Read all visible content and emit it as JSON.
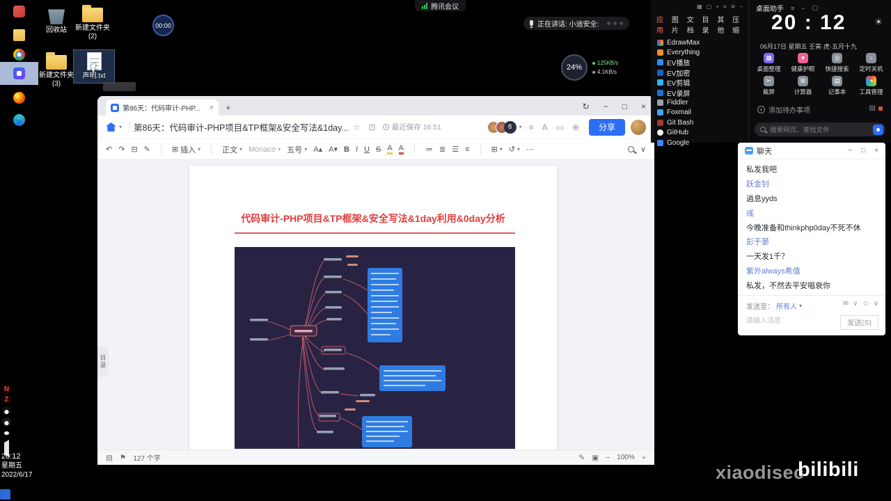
{
  "system": {
    "top_bar": {
      "app": "腾讯会议"
    },
    "speaking_pill": {
      "label": "正在讲话: 小迪安全:"
    },
    "timer": "00:00",
    "net_widget": {
      "percent": "24%",
      "up": "125KB/s",
      "down": "4.1KB/s"
    },
    "clock_small": {
      "time": "20:12",
      "weekday": "星期五",
      "date": "2022/6/17"
    },
    "watermark": {
      "author": "xiaodisec",
      "site": "bilibili"
    }
  },
  "desktop_icons": [
    {
      "label": "回收站"
    },
    {
      "label": "新建文件夹(2)"
    },
    {
      "label": "新建文件夹(3)"
    },
    {
      "label": "声明.txt"
    }
  ],
  "editor": {
    "tab_title": "第86天：代码审计-PHP...",
    "title": "第86天：代码审计-PHP项目&TP框架&安全写法&1day...",
    "saved_status": "最近保存 16:51",
    "collab_count": "8",
    "share_button": "分享",
    "toolbar": {
      "insert": "插入",
      "paragraph_style": "正文",
      "font_name": "Monaco",
      "font_size": "五号"
    },
    "document": {
      "heading": "代码审计-PHP项目&TP框架&安全写法&1day利用&0day分析"
    },
    "sidebar_tab": "目录",
    "status_bar": {
      "word_count": "127 个字",
      "zoom": "100%"
    }
  },
  "assistant": {
    "window_title": "桌面助手",
    "header_tabs": [
      "应用",
      "图片",
      "文档",
      "目录",
      "其他",
      "压缩"
    ],
    "apps": [
      "EdrawMax",
      "Everything",
      "EV播放",
      "EV加密",
      "EV剪辑",
      "EV录屏",
      "Fiddler",
      "Foxmail",
      "Git Bash",
      "GitHub",
      "Google"
    ],
    "time": "20 : 12",
    "date": "06月17日 星期五 壬寅·虎·五月十九",
    "tools": [
      "桌面整理",
      "健康护眼",
      "快捷搜索",
      "定时关机",
      "截屏",
      "计算器",
      "记事本",
      "工具管理"
    ],
    "todo_placeholder": "添加待办事项",
    "search_placeholder": "搜索网页、查找文件"
  },
  "chat": {
    "window_title": "聊天",
    "messages": [
      {
        "type": "message",
        "text": "私发我吧"
      },
      {
        "type": "sender",
        "text": "跃金钊"
      },
      {
        "type": "message",
        "text": "逍息yyds"
      },
      {
        "type": "sender",
        "text": "彧"
      },
      {
        "type": "message",
        "text": "今晚准备和thinkphp0day不死不休"
      },
      {
        "type": "sender",
        "text": "彭于晏"
      },
      {
        "type": "message",
        "text": "一天发1千？"
      },
      {
        "type": "sender",
        "text": "紫外always希值"
      },
      {
        "type": "message",
        "text": "私发，不然去平安唱衰你"
      }
    ],
    "send_to_label": "发送至：",
    "send_to_value": "所有人",
    "input_placeholder": "请输入消息",
    "send_button": "发送(S)"
  }
}
